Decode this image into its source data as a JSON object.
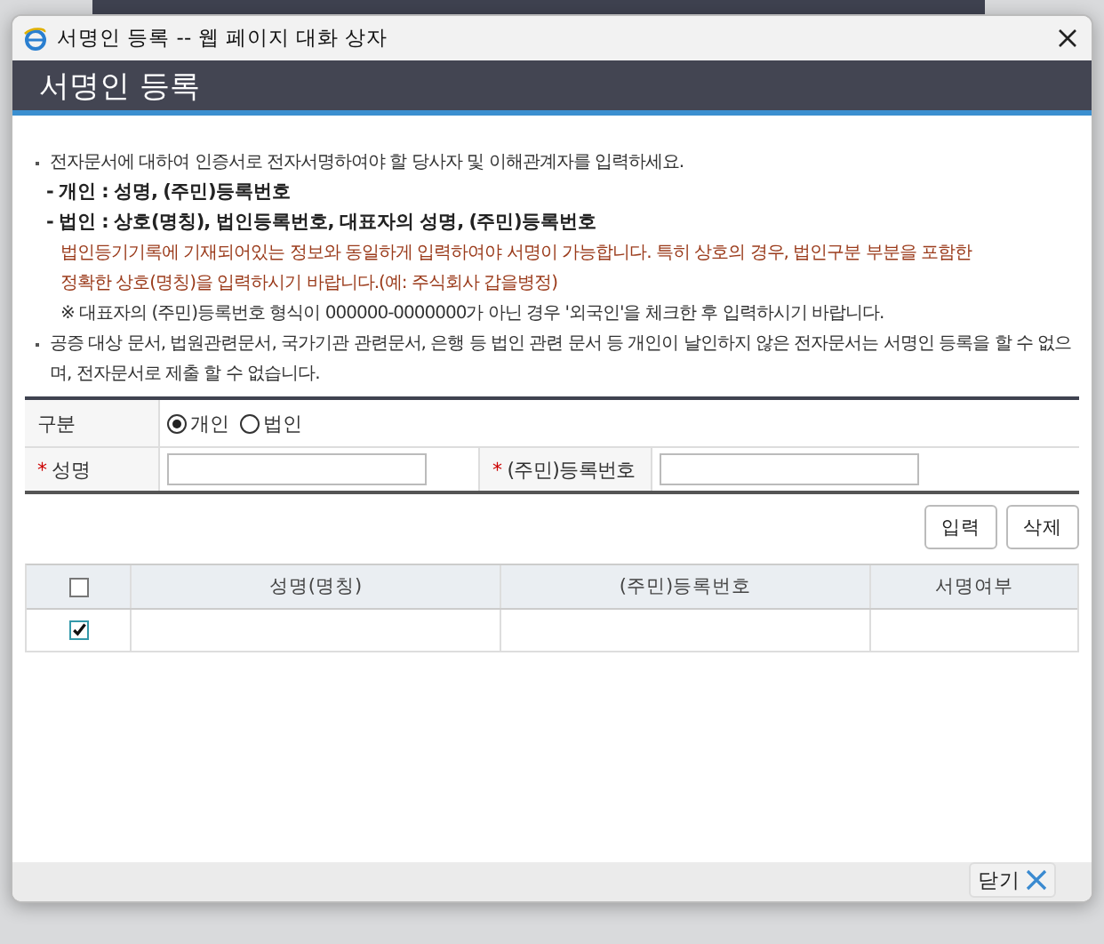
{
  "window": {
    "title": "서명인 등록 -- 웹 페이지 대화 상자"
  },
  "header": {
    "title": "서명인 등록"
  },
  "notes": [
    {
      "kind": "bullet",
      "text": "전자문서에 대하여 인증서로 전자서명하여야 할 당사자 및 이해관계자를 입력하세요."
    },
    {
      "kind": "dash",
      "text": "- 개인 : 성명, (주민)등록번호"
    },
    {
      "kind": "dash",
      "text": "- 법인 : 상호(명칭), 법인등록번호, 대표자의 성명, (주민)등록번호"
    },
    {
      "kind": "warning",
      "text": "법인등기기록에 기재되어있는 정보와 동일하게 입력하여야 서명이 가능합니다. 특히 상호의 경우, 법인구분 부분을 포함한"
    },
    {
      "kind": "warning",
      "text": "정확한 상호(명칭)을 입력하시기 바랍니다.(예: 주식회사 갑을병정)"
    },
    {
      "kind": "remark",
      "text": "※ 대표자의 (주민)등록번호 형식이 000000-0000000가 아닌 경우 '외국인'을 체크한 후 입력하시기 바랍니다."
    },
    {
      "kind": "bullet",
      "text": "공증 대상 문서, 법원관련문서, 국가기관 관련문서, 은행 등 법인 관련 문서 등 개인이 날인하지 않은 전자문서는 서명인 등록을 할 수 없으며, 전자문서로 제출 할 수 없습니다."
    }
  ],
  "form": {
    "type_label": "구분",
    "options": [
      {
        "label": "개인",
        "selected": true
      },
      {
        "label": "법인",
        "selected": false
      }
    ],
    "required_mark": "*",
    "name_label": "성명",
    "id_label": "(주민)등록번호"
  },
  "actions": [
    "입력",
    "삭제"
  ],
  "grid": {
    "select_all_checked": false,
    "columns": [
      "성명(명칭)",
      "(주민)등록번호",
      "서명여부"
    ],
    "rows": [
      {
        "checked": true
      }
    ]
  },
  "footer": {
    "close_button": "닫기"
  }
}
